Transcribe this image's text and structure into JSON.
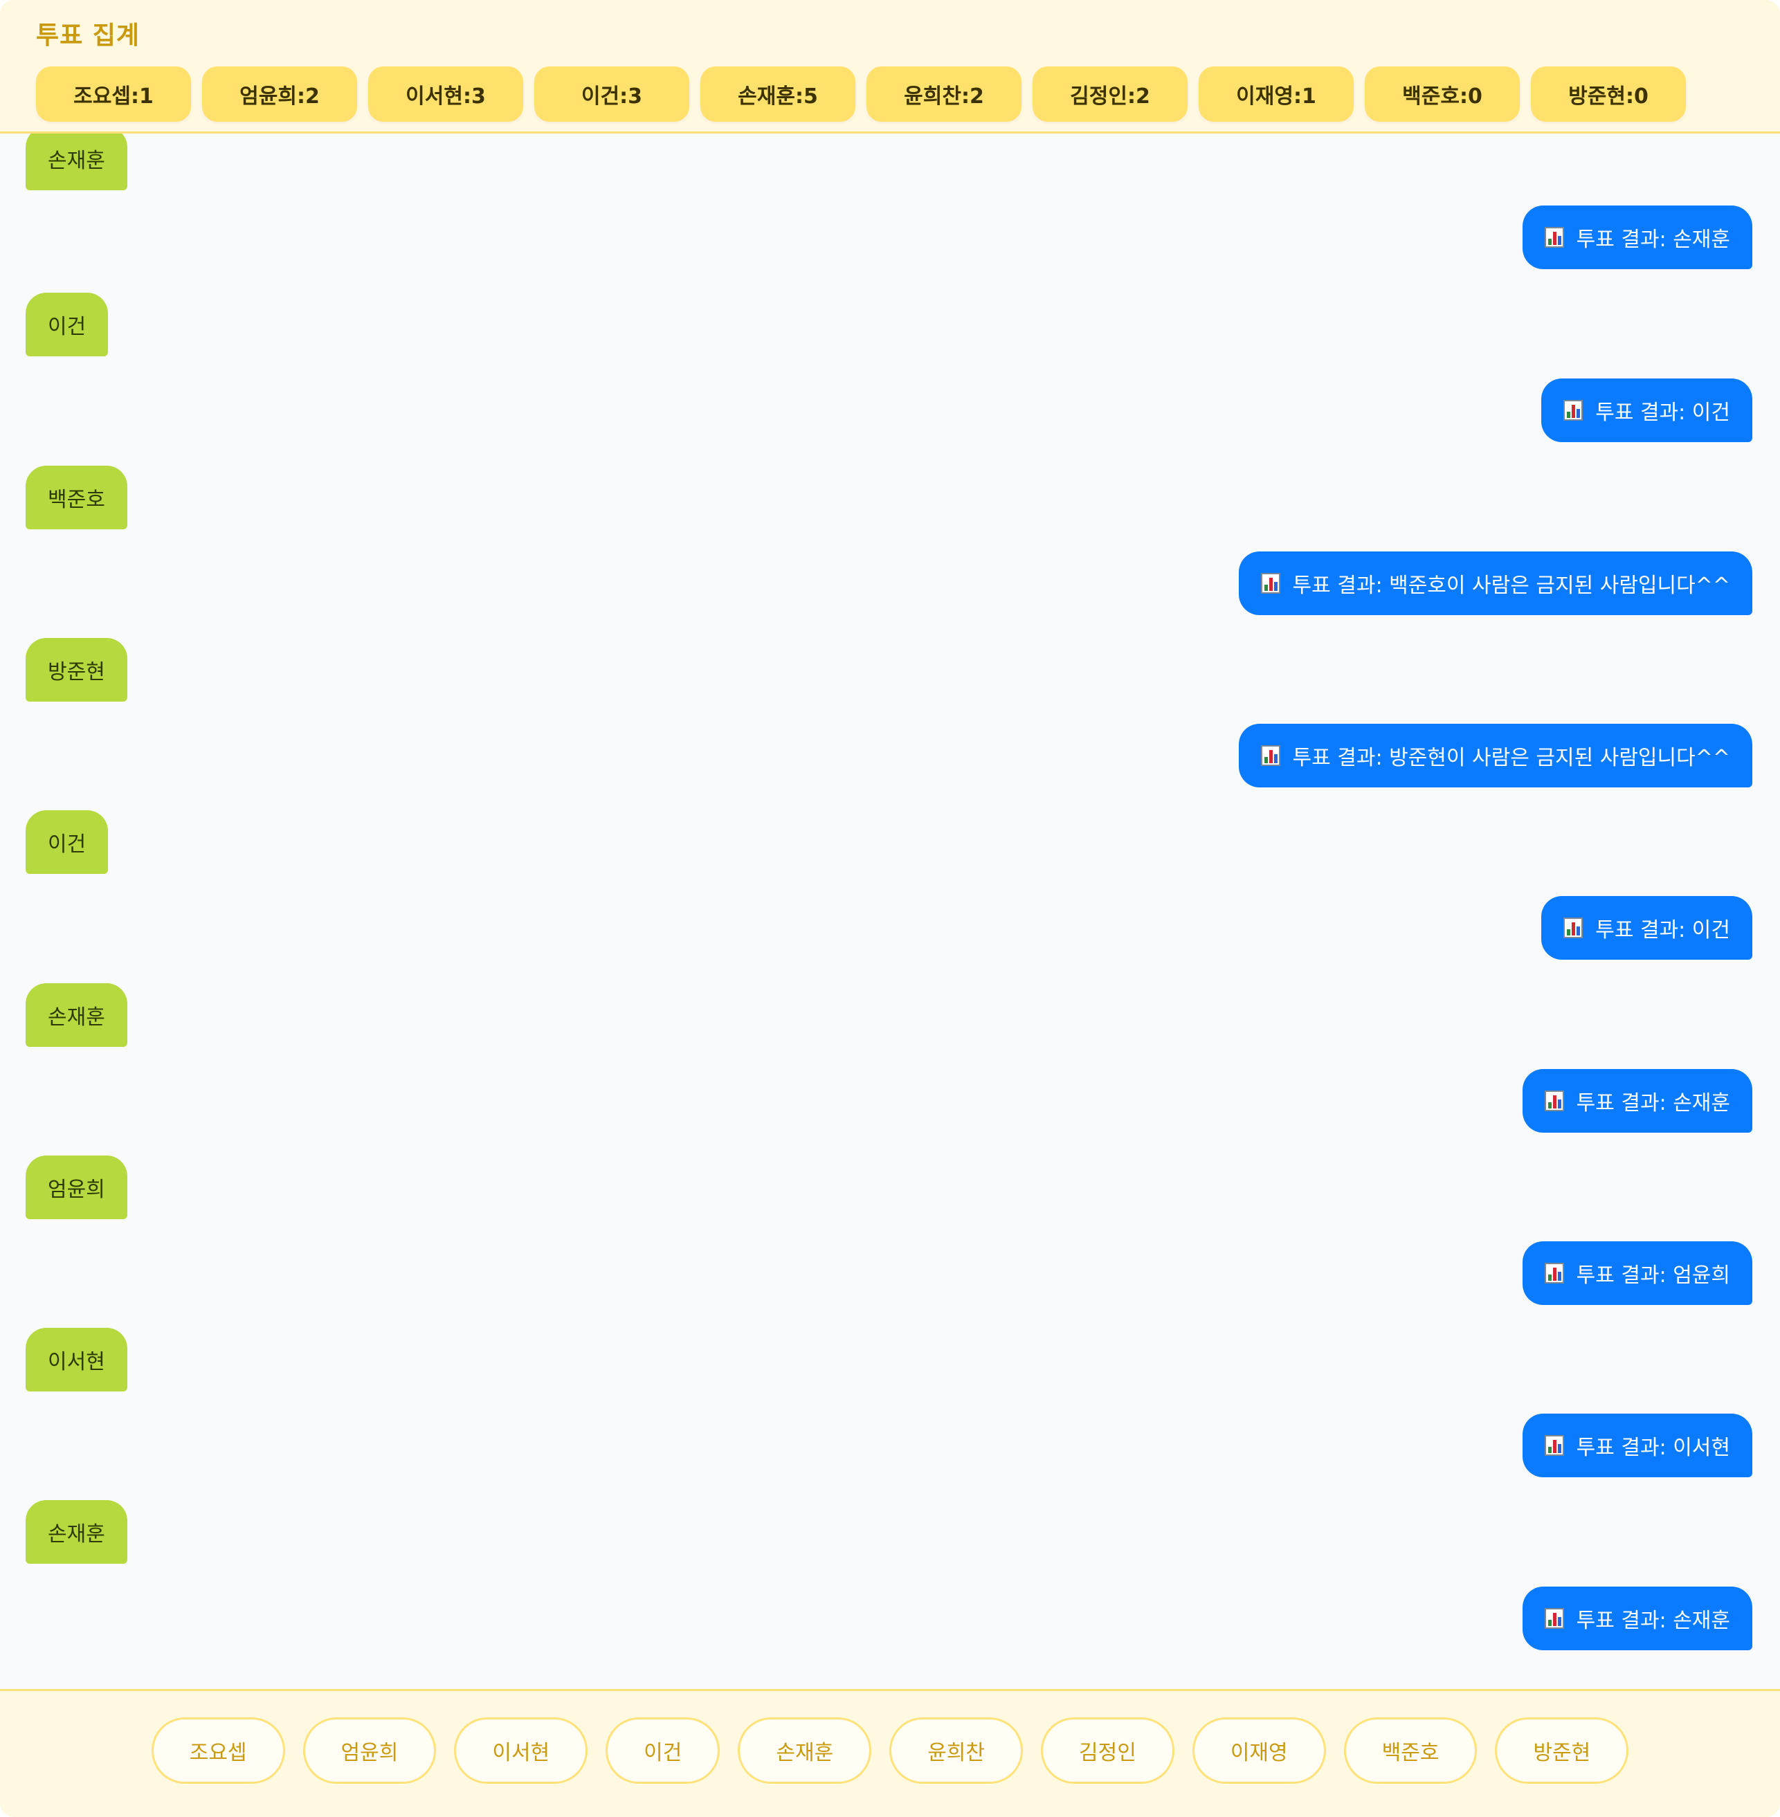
{
  "header": {
    "title": "투표 집계",
    "tallies": [
      "조요셉:1",
      "엄윤희:2",
      "이서현:3",
      "이건:3",
      "손재훈:5",
      "윤희찬:2",
      "김정인:2",
      "이재영:1",
      "백준호:0",
      "방준현:0"
    ]
  },
  "chat": {
    "result_icon": "bar-chart-icon",
    "messages": [
      {
        "role": "user",
        "text": "손재훈"
      },
      {
        "role": "bot",
        "text": "투표 결과: 손재훈"
      },
      {
        "role": "user",
        "text": "이건"
      },
      {
        "role": "bot",
        "text": "투표 결과: 이건"
      },
      {
        "role": "user",
        "text": "백준호"
      },
      {
        "role": "bot",
        "text": "투표 결과: 백준호이 사람은 금지된 사람입니다^^"
      },
      {
        "role": "user",
        "text": "방준현"
      },
      {
        "role": "bot",
        "text": "투표 결과: 방준현이 사람은 금지된 사람입니다^^"
      },
      {
        "role": "user",
        "text": "이건"
      },
      {
        "role": "bot",
        "text": "투표 결과: 이건"
      },
      {
        "role": "user",
        "text": "손재훈"
      },
      {
        "role": "bot",
        "text": "투표 결과: 손재훈"
      },
      {
        "role": "user",
        "text": "엄윤희"
      },
      {
        "role": "bot",
        "text": "투표 결과: 엄윤희"
      },
      {
        "role": "user",
        "text": "이서현"
      },
      {
        "role": "bot",
        "text": "투표 결과: 이서현"
      },
      {
        "role": "user",
        "text": "손재훈"
      },
      {
        "role": "bot",
        "text": "투표 결과: 손재훈"
      }
    ]
  },
  "footer": {
    "vote_buttons": [
      "조요셉",
      "엄윤희",
      "이서현",
      "이건",
      "손재훈",
      "윤희찬",
      "김정인",
      "이재영",
      "백준호",
      "방준현"
    ]
  },
  "colors": {
    "accent": "#C99A0E",
    "tally_bg": "#FFE16C",
    "user_bubble": "#B5D93E",
    "bot_bubble": "#0A7BFF",
    "panel_bg": "#FFF9E1"
  }
}
